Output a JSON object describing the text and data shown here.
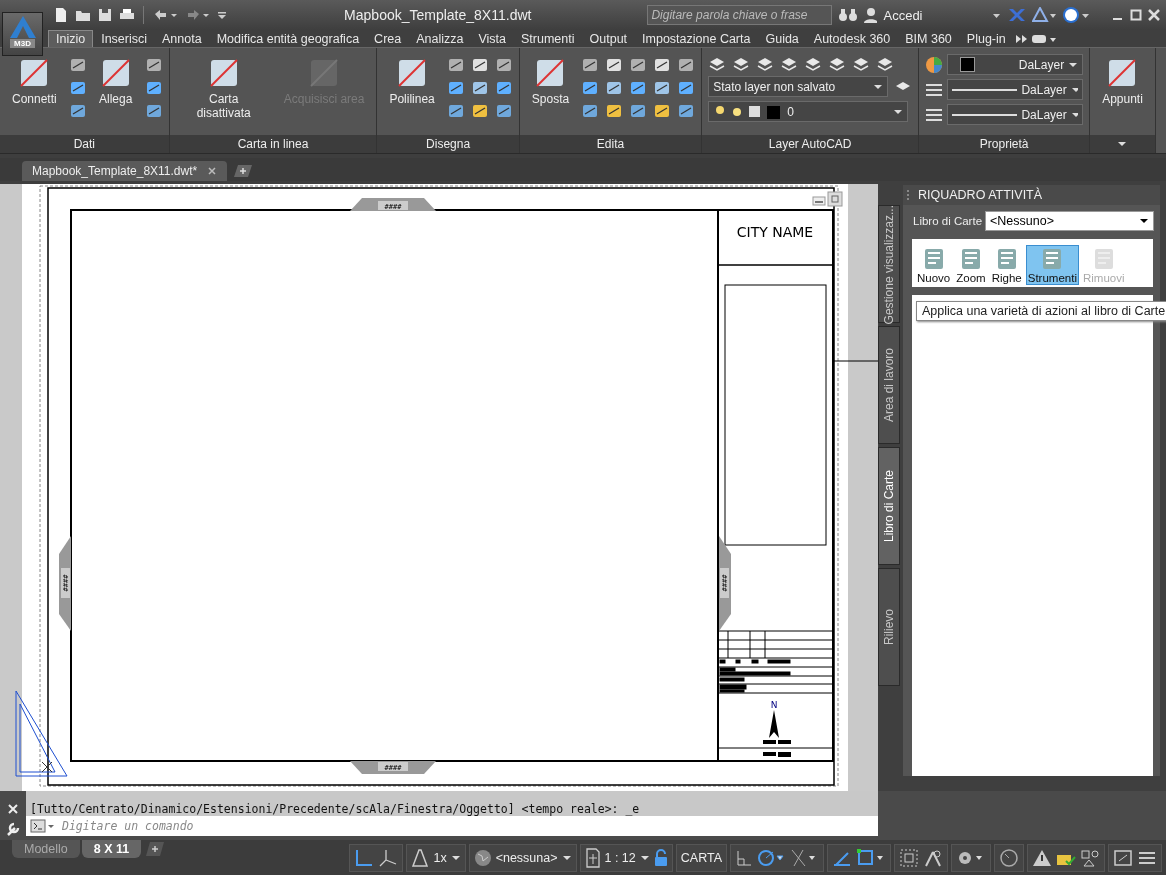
{
  "app_button": {
    "label": "M3D"
  },
  "title": "Mapbook_Template_8X11.dwt",
  "search": {
    "placeholder": "Digitare parola chiave o frase"
  },
  "sign_in": "Accedi",
  "ribbon_tabs": [
    {
      "label": "Inizio",
      "selected": true
    },
    {
      "label": "Inserisci",
      "selected": false
    },
    {
      "label": "Annota",
      "selected": false
    },
    {
      "label": "Modifica entità geografica",
      "selected": false
    },
    {
      "label": "Crea",
      "selected": false
    },
    {
      "label": "Analizza",
      "selected": false
    },
    {
      "label": "Vista",
      "selected": false
    },
    {
      "label": "Strumenti",
      "selected": false
    },
    {
      "label": "Output",
      "selected": false
    },
    {
      "label": "Impostazione Carta",
      "selected": false
    },
    {
      "label": "Guida",
      "selected": false
    },
    {
      "label": "Autodesk 360",
      "selected": false
    },
    {
      "label": "BIM 360",
      "selected": false
    },
    {
      "label": "Plug-in",
      "selected": false
    }
  ],
  "ribbon_panels": [
    {
      "kind": "tools",
      "title": "Dati",
      "items": [
        {
          "kind": "large",
          "label": "Connetti",
          "disabled": false
        },
        {
          "kind": "icons"
        },
        {
          "kind": "large",
          "label": "Allega",
          "disabled": false
        },
        {
          "kind": "icons"
        }
      ]
    },
    {
      "kind": "tools",
      "title": "Carta in linea",
      "items": [
        {
          "kind": "large",
          "label": "Carta disattivata",
          "disabled": false
        },
        {
          "kind": "large",
          "label": "Acquisisci area",
          "disabled": true
        }
      ]
    },
    {
      "kind": "tools",
      "title": "Disegna",
      "items": [
        {
          "kind": "large",
          "label": "Polilinea",
          "disabled": false
        },
        {
          "kind": "icons"
        },
        {
          "kind": "icons"
        },
        {
          "kind": "icons"
        }
      ]
    },
    {
      "kind": "tools",
      "title": "Edita",
      "items": [
        {
          "kind": "large",
          "label": "Sposta",
          "disabled": false
        },
        {
          "kind": "icons"
        },
        {
          "kind": "icons"
        },
        {
          "kind": "icons"
        },
        {
          "kind": "icons"
        },
        {
          "kind": "icons"
        }
      ]
    },
    {
      "kind": "layers",
      "title": "Layer AutoCAD",
      "layer_state": "Stato layer non salvato",
      "current_layer": "0"
    },
    {
      "kind": "properties",
      "title": "Proprietà",
      "values": [
        "DaLayer",
        "DaLayer",
        "DaLayer"
      ]
    },
    {
      "kind": "tools",
      "items": [
        {
          "kind": "large",
          "label": "Appunti",
          "disabled": false
        }
      ]
    }
  ],
  "document_tab": {
    "label": "Mapbook_Template_8X11.dwt*"
  },
  "drawing": {
    "city_name": "CITY NAME",
    "north_label": "N",
    "edge_markers": [
      "####",
      "####",
      "####",
      "####"
    ]
  },
  "task_pane": {
    "title": "RIQUADRO ATTIVITÀ",
    "side_tabs": [
      {
        "label": "Gestione visualizzaz...",
        "selected": false
      },
      {
        "label": "Area di lavoro",
        "selected": false
      },
      {
        "label": "Libro di Carte",
        "selected": true
      },
      {
        "label": "Rilievo",
        "selected": false
      }
    ],
    "book_label": "Libro di Carte",
    "book_value": "<Nessuno>",
    "tools": [
      {
        "label": "Nuovo",
        "selected": false,
        "disabled": false
      },
      {
        "label": "Zoom",
        "selected": false,
        "disabled": false
      },
      {
        "label": "Righe",
        "selected": false,
        "disabled": false
      },
      {
        "label": "Strumenti",
        "selected": true,
        "disabled": false
      },
      {
        "label": "Rimuovi",
        "selected": false,
        "disabled": true
      }
    ],
    "tooltip": "Applica una varietà di azioni al libro di Carte"
  },
  "command_line": {
    "history": "[Tutto/Centrato/Dinamico/Estensioni/Precedente/scAla/Finestra/Oggetto] <tempo reale>: _e",
    "placeholder": "Digitare un comando"
  },
  "status_bar": {
    "layout_tabs": [
      {
        "label": "Modello",
        "selected": false
      },
      {
        "label": "8 X 11",
        "selected": true
      }
    ],
    "annotation_scale": "1x",
    "coordinate_system": "<nessuna>",
    "viewport_scale": "1 : 12",
    "space": "CARTA"
  }
}
